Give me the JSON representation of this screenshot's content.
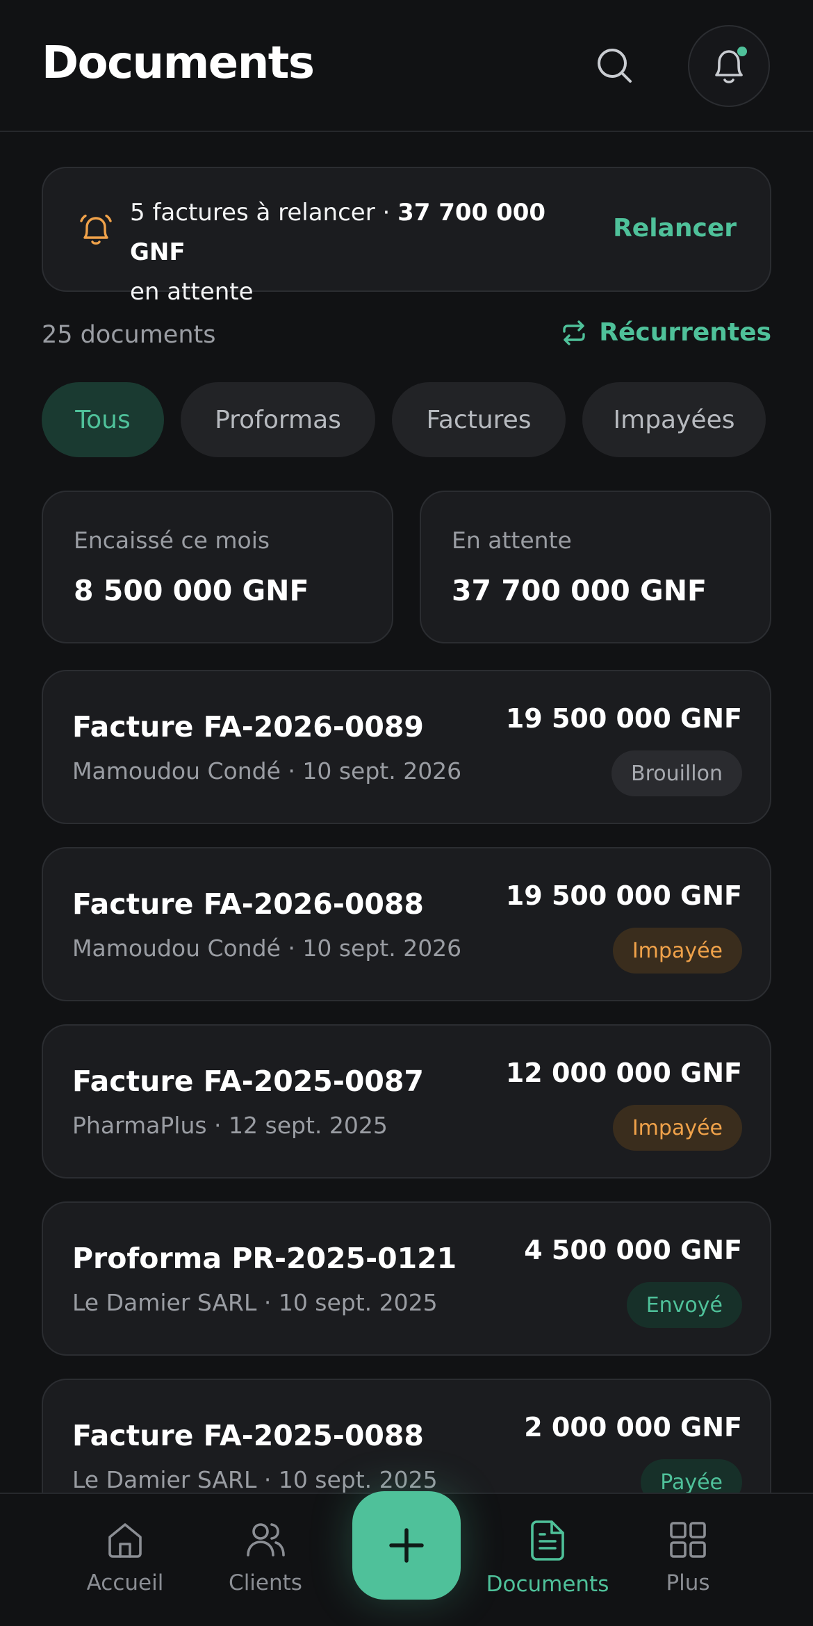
{
  "header": {
    "title": "Documents",
    "search_icon": "search-icon",
    "notifications_icon": "bell-icon",
    "has_unread": true
  },
  "reminder": {
    "text_prefix": "5 factures à relancer · ",
    "amount": "37 700 000 GNF",
    "text_suffix": "en attente",
    "action_label": "Relancer",
    "icon": "bell-icon",
    "icon_color": "#f0a24a"
  },
  "summary": {
    "count_label": "25 documents",
    "recurrent_label": "Récurrentes",
    "recurrent_icon": "repeat-icon"
  },
  "filters": [
    {
      "label": "Tous",
      "active": true
    },
    {
      "label": "Proformas",
      "active": false
    },
    {
      "label": "Factures",
      "active": false
    },
    {
      "label": "Impayées",
      "active": false
    }
  ],
  "stats": [
    {
      "label": "Encaissé ce mois",
      "value": "8 500 000 GNF"
    },
    {
      "label": "En attente",
      "value": "37 700 000 GNF"
    }
  ],
  "documents": [
    {
      "title": "Facture FA-2026-0089",
      "subtitle": "Mamoudou Condé · 10 sept. 2026",
      "amount": "19 500 000 GNF",
      "status": "Brouillon"
    },
    {
      "title": "Facture FA-2026-0088",
      "subtitle": "Mamoudou Condé · 10 sept. 2026",
      "amount": "19 500 000 GNF",
      "status": "Impayée"
    },
    {
      "title": "Facture FA-2025-0087",
      "subtitle": "PharmaPlus · 12 sept. 2025",
      "amount": "12 000 000 GNF",
      "status": "Impayée"
    },
    {
      "title": "Proforma PR-2025-0121",
      "subtitle": "Le Damier SARL · 10 sept. 2025",
      "amount": "4 500 000 GNF",
      "status": "Envoyé"
    },
    {
      "title": "Facture FA-2025-0088",
      "subtitle": "Le Damier SARL · 10 sept. 2025",
      "amount": "2 000 000 GNF",
      "status": "Payée"
    }
  ],
  "nav": {
    "items": [
      {
        "label": "Accueil",
        "icon": "home-icon",
        "active": false
      },
      {
        "label": "Clients",
        "icon": "users-icon",
        "active": false
      },
      {
        "label": "Documents",
        "icon": "document-icon",
        "active": true
      },
      {
        "label": "Plus",
        "icon": "grid-icon",
        "active": false
      }
    ],
    "fab_icon": "plus-icon"
  },
  "colors": {
    "background": "#111214",
    "card": "#1b1c1f",
    "accent": "#4fc19a",
    "warning": "#f0a24a",
    "muted_text": "#9a9da3"
  }
}
